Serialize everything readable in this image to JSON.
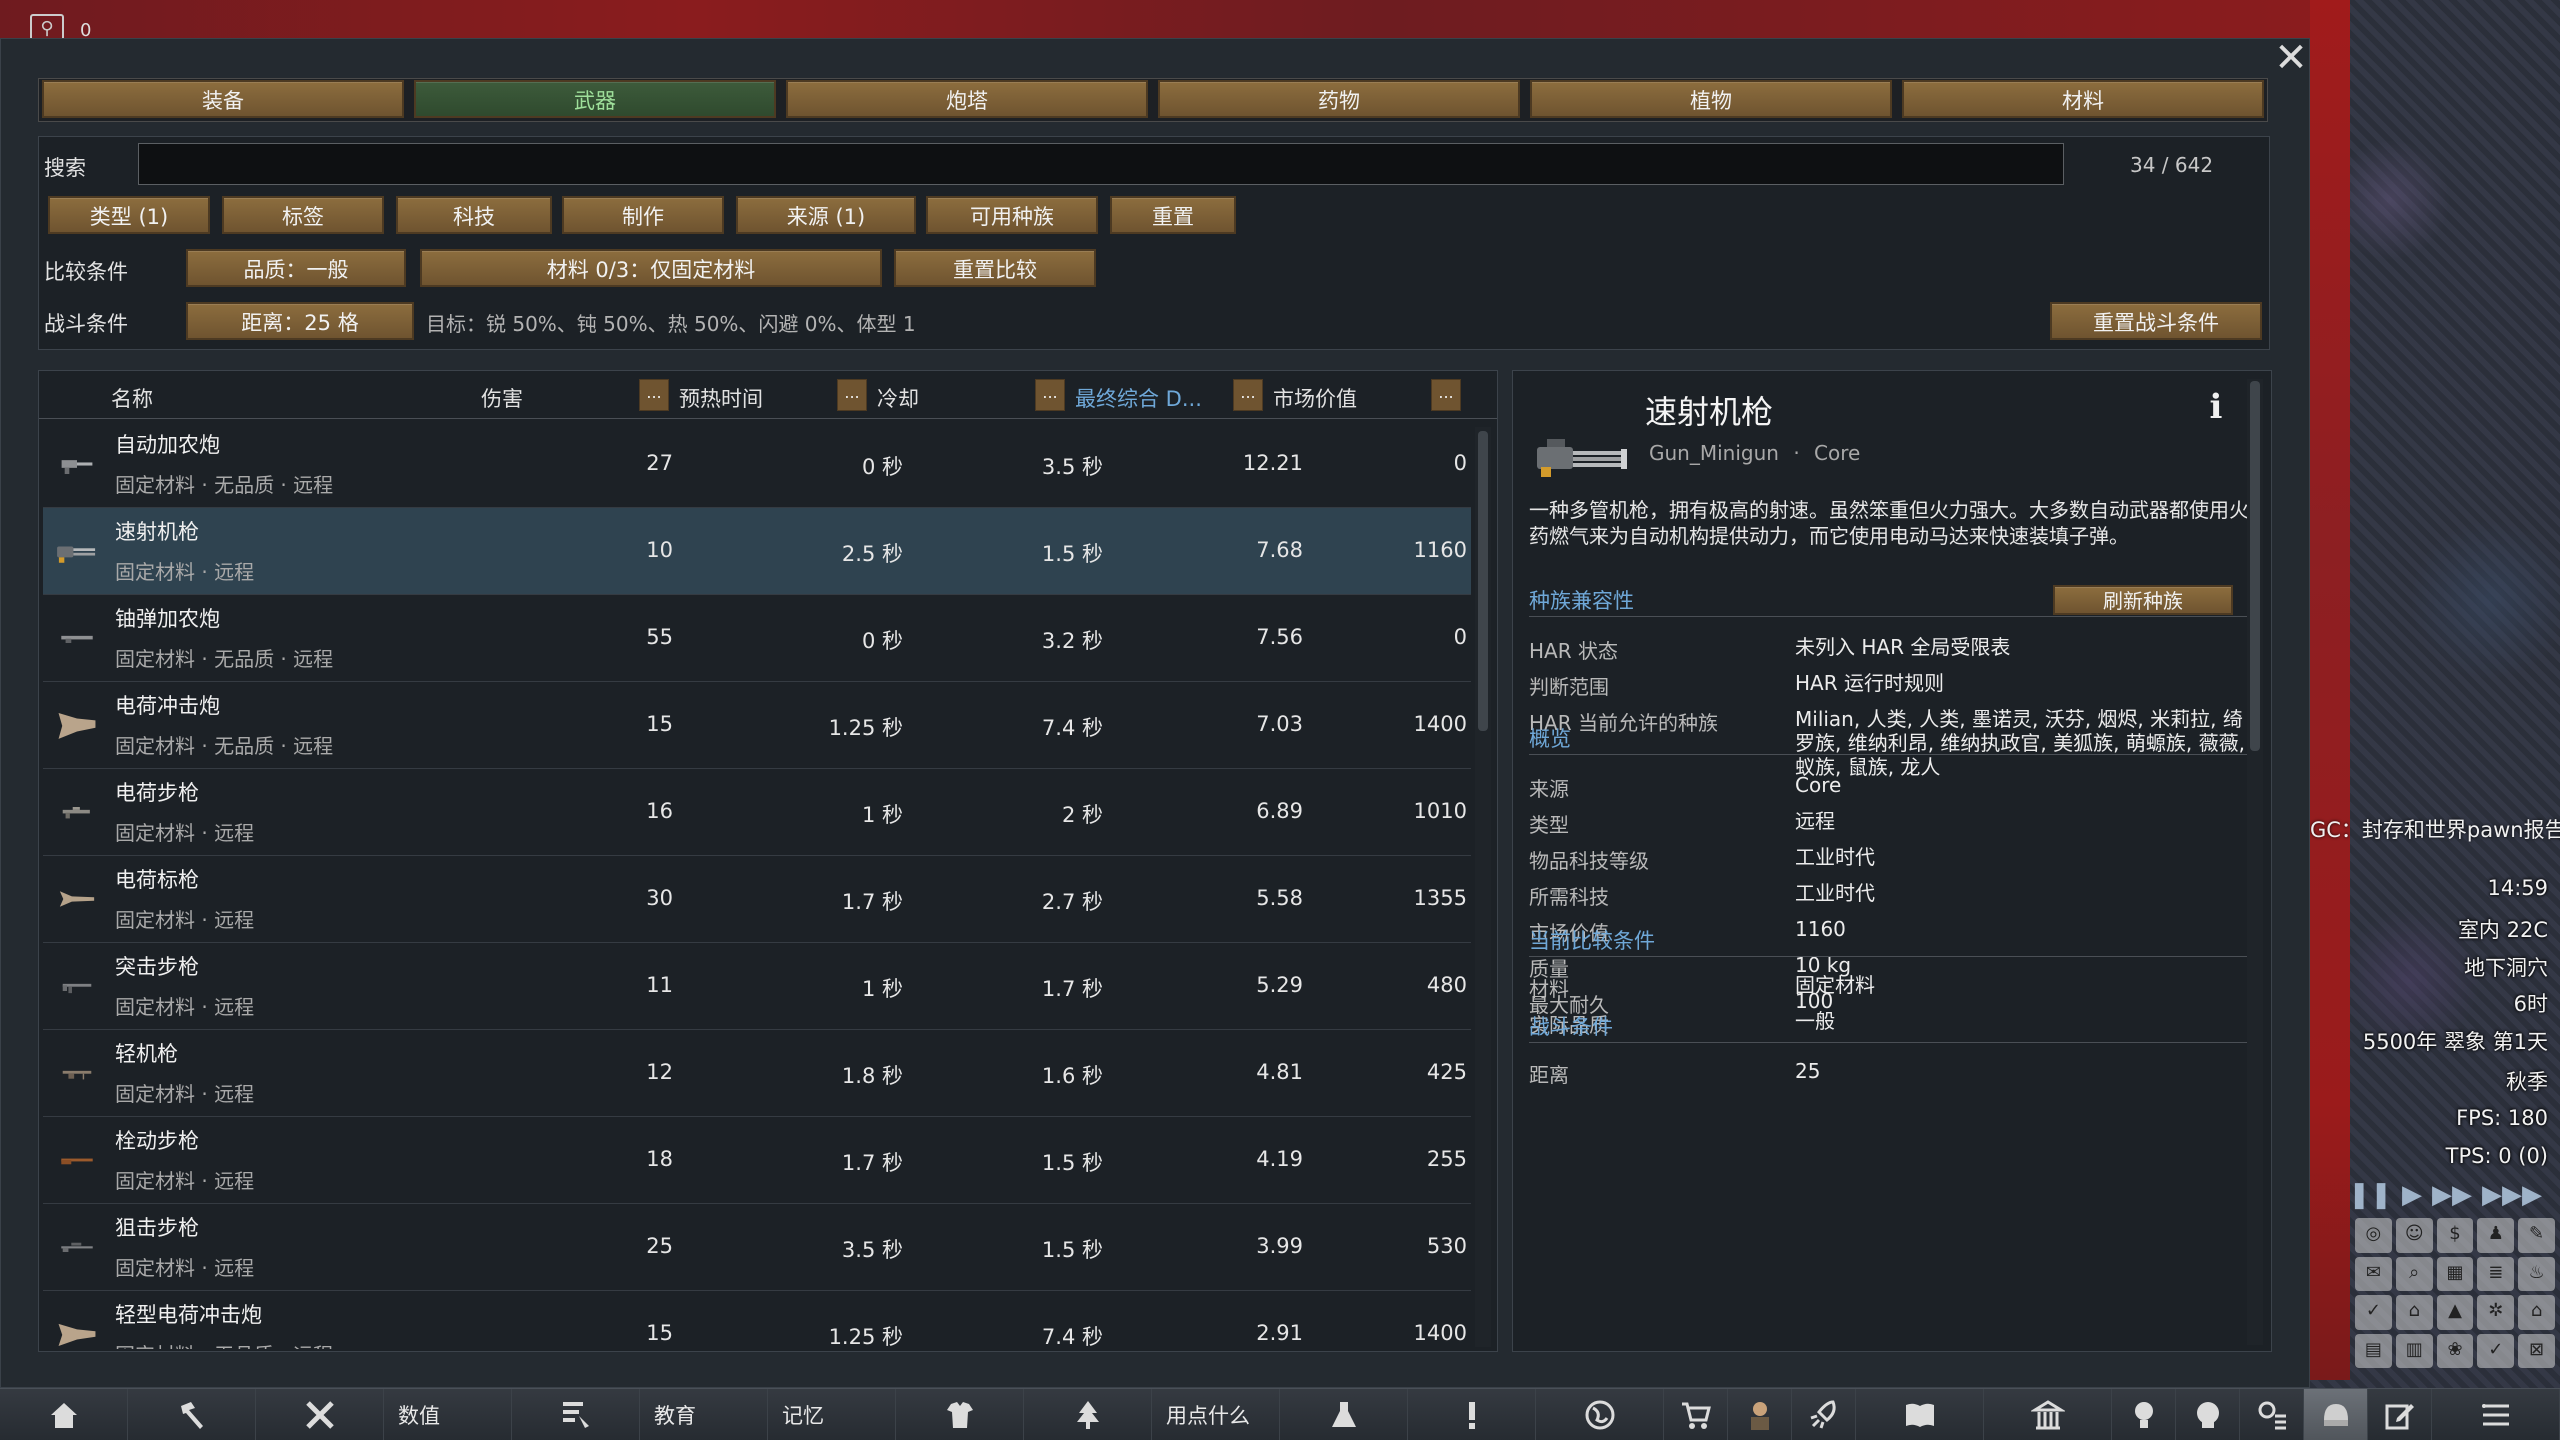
{
  "topleft": {
    "count": "0"
  },
  "tabs": [
    {
      "label": "装备",
      "active": false
    },
    {
      "label": "武器",
      "active": true
    },
    {
      "label": "炮塔",
      "active": false
    },
    {
      "label": "药物",
      "active": false
    },
    {
      "label": "植物",
      "active": false
    },
    {
      "label": "材料",
      "active": false
    }
  ],
  "search": {
    "label": "搜索",
    "value": "",
    "result_count": "34 / 642"
  },
  "filters": {
    "type": "类型 (1)",
    "tags": "标签",
    "tech": "科技",
    "craft": "制作",
    "source": "来源 (1)",
    "races": "可用种族",
    "reset": "重置"
  },
  "compare": {
    "label": "比较条件",
    "quality": "品质：一般",
    "material": "材料 0/3：仅固定材料",
    "reset": "重置比较"
  },
  "combat": {
    "label": "战斗条件",
    "distance": "距离：25 格",
    "target": "目标：锐 50%、钝 50%、热 50%、闪避 0%、体型 1",
    "reset": "重置战斗条件"
  },
  "table": {
    "headers": {
      "name": "名称",
      "damage": "伤害",
      "warmup": "预热时间",
      "cooldown": "冷却",
      "dps": "最终综合 D...",
      "value": "市场价值",
      "more": "..."
    },
    "rows": [
      {
        "name": "自动加农炮",
        "sub": "固定材料 · 无品质 · 远程",
        "damage": "27",
        "warmup": "0 秒",
        "cooldown": "3.5 秒",
        "dps": "12.21",
        "value": "0",
        "icon": "autocannon",
        "selected": false
      },
      {
        "name": "速射机枪",
        "sub": "固定材料 · 远程",
        "damage": "10",
        "warmup": "2.5 秒",
        "cooldown": "1.5 秒",
        "dps": "7.68",
        "value": "1160",
        "icon": "minigun",
        "selected": true
      },
      {
        "name": "铀弹加农炮",
        "sub": "固定材料 · 无品质 · 远程",
        "damage": "55",
        "warmup": "0 秒",
        "cooldown": "3.2 秒",
        "dps": "7.56",
        "value": "0",
        "icon": "uranium-cannon",
        "selected": false
      },
      {
        "name": "电荷冲击炮",
        "sub": "固定材料 · 无品质 · 远程",
        "damage": "15",
        "warmup": "1.25 秒",
        "cooldown": "7.4 秒",
        "dps": "7.03",
        "value": "1400",
        "icon": "charge-blaster",
        "selected": false
      },
      {
        "name": "电荷步枪",
        "sub": "固定材料 · 远程",
        "damage": "16",
        "warmup": "1 秒",
        "cooldown": "2 秒",
        "dps": "6.89",
        "value": "1010",
        "icon": "charge-rifle",
        "selected": false
      },
      {
        "name": "电荷标枪",
        "sub": "固定材料 · 远程",
        "damage": "30",
        "warmup": "1.7 秒",
        "cooldown": "2.7 秒",
        "dps": "5.58",
        "value": "1355",
        "icon": "charge-lance",
        "selected": false
      },
      {
        "name": "突击步枪",
        "sub": "固定材料 · 远程",
        "damage": "11",
        "warmup": "1 秒",
        "cooldown": "1.7 秒",
        "dps": "5.29",
        "value": "480",
        "icon": "assault-rifle",
        "selected": false
      },
      {
        "name": "轻机枪",
        "sub": "固定材料 · 远程",
        "damage": "12",
        "warmup": "1.8 秒",
        "cooldown": "1.6 秒",
        "dps": "4.81",
        "value": "425",
        "icon": "lmg",
        "selected": false
      },
      {
        "name": "栓动步枪",
        "sub": "固定材料 · 远程",
        "damage": "18",
        "warmup": "1.7 秒",
        "cooldown": "1.5 秒",
        "dps": "4.19",
        "value": "255",
        "icon": "bolt-rifle",
        "selected": false
      },
      {
        "name": "狙击步枪",
        "sub": "固定材料 · 远程",
        "damage": "25",
        "warmup": "3.5 秒",
        "cooldown": "1.5 秒",
        "dps": "3.99",
        "value": "530",
        "icon": "sniper-rifle",
        "selected": false
      },
      {
        "name": "轻型电荷冲击炮",
        "sub": "固定材料 · 无品质 · 远程",
        "damage": "15",
        "warmup": "1.25 秒",
        "cooldown": "7.4 秒",
        "dps": "2.91",
        "value": "1400",
        "icon": "light-charge-blaster",
        "selected": false
      }
    ]
  },
  "detail": {
    "title": "速射机枪",
    "defname": "Gun_Minigun",
    "source_tag": "Core",
    "dot": "·",
    "description": "一种多管机枪，拥有极高的射速。虽然笨重但火力强大。大多数自动武器都使用火药燃气来为自动机构提供动力，而它使用电动马达来快速装填子弹。",
    "race_section": "种族兼容性",
    "refresh_races": "刷新种族",
    "race_rows": [
      {
        "k": "HAR 状态",
        "v": "未列入 HAR 全局受限表"
      },
      {
        "k": "判断范围",
        "v": "HAR 运行时规则"
      },
      {
        "k": "HAR 当前允许的种族",
        "v": "Milian, 人类, 人类, 墨诺灵, 沃芬, 烟烬, 米莉拉, 绮罗族, 维纳利昂, 维纳执政官, 美狐族, 萌螈族, 薇薇, 蚁族, 鼠族, 龙人"
      }
    ],
    "overview_section": "概览",
    "overview_rows": [
      {
        "k": "来源",
        "v": "Core"
      },
      {
        "k": "类型",
        "v": "远程"
      },
      {
        "k": "物品科技等级",
        "v": "工业时代"
      },
      {
        "k": "所需科技",
        "v": "工业时代"
      },
      {
        "k": "市场价值",
        "v": "1160"
      },
      {
        "k": "质量",
        "v": "10 kg"
      },
      {
        "k": "最大耐久",
        "v": "100"
      }
    ],
    "compare_section": "当前比较条件",
    "compare_rows": [
      {
        "k": "材料",
        "v": "固定材料"
      },
      {
        "k": "实际品质",
        "v": "一般"
      }
    ],
    "combat_section": "战斗条件",
    "combat_rows": [
      {
        "k": "距离",
        "v": "25"
      }
    ]
  },
  "hud": {
    "alert": "GC：封存和世界pawn报告",
    "time": "14:59",
    "temp": "室内 22C",
    "location": "地下洞穴",
    "hour": "6时",
    "date": "5500年 翠象 第1天",
    "season": "秋季",
    "fps": "FPS: 180",
    "tps": "TPS: 0 (0)"
  },
  "bottom_bar": {
    "stats": "数值",
    "education": "教育",
    "memory": "记忆",
    "what_to_use": "用点什么"
  }
}
